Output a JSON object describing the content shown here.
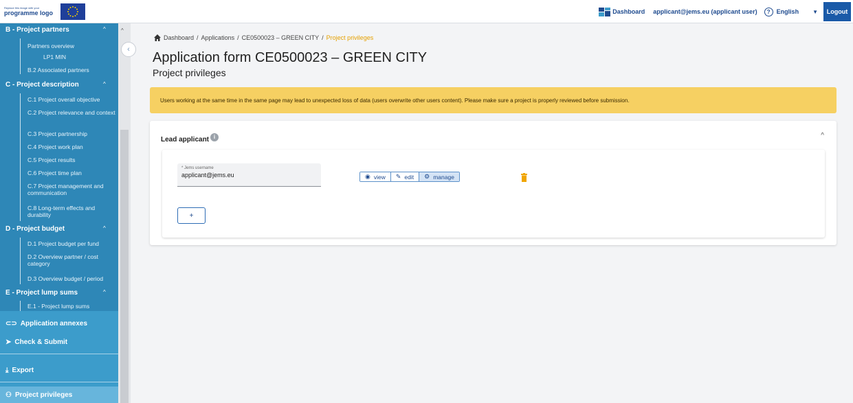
{
  "header": {
    "logo_small_text": "Replace this image with your",
    "logo_main_text": "programme logo",
    "dashboard_label": "Dashboard",
    "user_label": "applicant@jems.eu (applicant user)",
    "language_label": "English",
    "logout_label": "Logout"
  },
  "sidebar": {
    "section_b": "B - Project partners",
    "b_items": [
      "Partners overview",
      "LP1 MIN",
      "B.2 Associated partners"
    ],
    "section_c": "C - Project description",
    "c_items": [
      "C.1 Project overall objective",
      "C.2 Project relevance and context",
      "C.3 Project partnership",
      "C.4 Project work plan",
      "C.5 Project results",
      "C.6 Project time plan",
      "C.7 Project management and communication",
      "C.8 Long-term effects and durability"
    ],
    "section_d": "D - Project budget",
    "d_items": [
      "D.1 Project budget per fund",
      "D.2 Overview partner / cost category",
      "D.3 Overview budget / period"
    ],
    "section_e": "E - Project lump sums",
    "e_items": [
      "E.1 - Project lump sums"
    ],
    "application_annexes": "Application annexes",
    "check_submit": "Check & Submit",
    "export": "Export",
    "project_privileges": "Project privileges"
  },
  "breadcrumb": {
    "items": [
      "Dashboard",
      "Applications",
      "CE0500023 – GREEN CITY"
    ],
    "separator": "/",
    "current": "Project privileges"
  },
  "page": {
    "title": "Application form CE0500023 – GREEN CITY",
    "subtitle": "Project privileges",
    "warning": "Users working at the same time in the same page may lead to unexpected loss of data (users overwrite other users content). Please make sure a project is properly reviewed before submission."
  },
  "lead_applicant": {
    "title": "Lead applicant",
    "field_label": "* Jems username",
    "field_value": "applicant@jems.eu",
    "privileges": [
      "view",
      "edit",
      "manage"
    ],
    "selected_privilege": "manage",
    "add_label": "+"
  },
  "colors": {
    "sidebar": "#3c9ccb",
    "sidebar_inner": "#2e87b7",
    "warning": "#f6d062",
    "primary": "#1a5aa8",
    "breadcrumb_current": "#e6a100",
    "trash": "#f0a500"
  }
}
